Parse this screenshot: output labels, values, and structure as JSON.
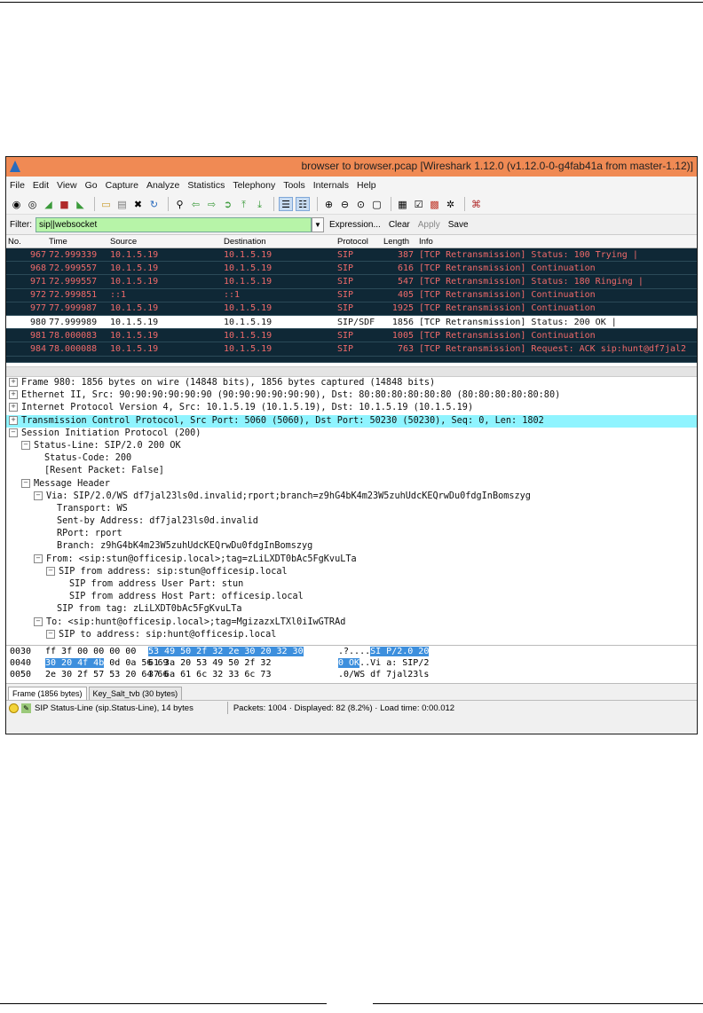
{
  "window": {
    "title": "browser to browser.pcap  [Wireshark 1.12.0  (v1.12.0-0-g4fab41a from master-1.12)]"
  },
  "menu": [
    "File",
    "Edit",
    "View",
    "Go",
    "Capture",
    "Analyze",
    "Statistics",
    "Telephony",
    "Tools",
    "Internals",
    "Help"
  ],
  "filter": {
    "label": "Filter:",
    "value": "sip||websocket",
    "expression": "Expression...",
    "clear": "Clear",
    "apply": "Apply",
    "save": "Save"
  },
  "packet_list": {
    "columns": [
      "No.",
      "Time",
      "Source",
      "Destination",
      "Protocol",
      "Length",
      "Info"
    ],
    "rows": [
      {
        "no": "967",
        "time": "72.999339",
        "src": "10.1.5.19",
        "dst": "10.1.5.19",
        "proto": "SIP",
        "len": "387",
        "info": "[TCP Retransmission] Status: 100 Trying |"
      },
      {
        "no": "968",
        "time": "72.999557",
        "src": "10.1.5.19",
        "dst": "10.1.5.19",
        "proto": "SIP",
        "len": "616",
        "info": "[TCP Retransmission] Continuation"
      },
      {
        "no": "971",
        "time": "72.999557",
        "src": "10.1.5.19",
        "dst": "10.1.5.19",
        "proto": "SIP",
        "len": "547",
        "info": "[TCP Retransmission] Status: 180 Ringing |"
      },
      {
        "no": "972",
        "time": "72.999851",
        "src": "::1",
        "dst": "::1",
        "proto": "SIP",
        "len": "405",
        "info": "[TCP Retransmission] Continuation"
      },
      {
        "no": "977",
        "time": "77.999987",
        "src": "10.1.5.19",
        "dst": "10.1.5.19",
        "proto": "SIP",
        "len": "1925",
        "info": "[TCP Retransmission] Continuation"
      },
      {
        "no": "980",
        "time": "77.999989",
        "src": "10.1.5.19",
        "dst": "10.1.5.19",
        "proto": "SIP/SDF",
        "len": "1856",
        "info": "[TCP Retransmission] Status: 200 OK |"
      },
      {
        "no": "981",
        "time": "78.000083",
        "src": "10.1.5.19",
        "dst": "10.1.5.19",
        "proto": "SIP",
        "len": "1005",
        "info": "[TCP Retransmission] Continuation"
      },
      {
        "no": "984",
        "time": "78.000088",
        "src": "10.1.5.19",
        "dst": "10.1.5.19",
        "proto": "SIP",
        "len": "763",
        "info": "[TCP Retransmission] Request: ACK sip:hunt@df7jal2"
      }
    ]
  },
  "details": [
    {
      "indent": 0,
      "exp": "+",
      "text": "Frame 980: 1856 bytes on wire (14848 bits), 1856 bytes captured (14848 bits)"
    },
    {
      "indent": 0,
      "exp": "+",
      "text": "Ethernet II, Src: 90:90:90:90:90:90 (90:90:90:90:90:90), Dst: 80:80:80:80:80:80 (80:80:80:80:80:80)"
    },
    {
      "indent": 0,
      "exp": "+",
      "text": "Internet Protocol Version 4, Src: 10.1.5.19 (10.1.5.19), Dst: 10.1.5.19 (10.1.5.19)"
    },
    {
      "indent": 0,
      "exp": "+",
      "text": "Transmission Control Protocol, Src Port: 5060 (5060), Dst Port: 50230 (50230), Seq: 0, Len: 1802",
      "hl": true
    },
    {
      "indent": 0,
      "exp": "-",
      "text": "Session Initiation Protocol (200)"
    },
    {
      "indent": 1,
      "exp": "-",
      "text": "Status-Line: SIP/2.0 200 OK"
    },
    {
      "indent": 3,
      "exp": "",
      "text": "Status-Code: 200"
    },
    {
      "indent": 3,
      "exp": "",
      "text": "[Resent Packet: False]"
    },
    {
      "indent": 1,
      "exp": "-",
      "text": "Message Header"
    },
    {
      "indent": 2,
      "exp": "-",
      "text": "Via: SIP/2.0/WS df7jal23ls0d.invalid;rport;branch=z9hG4bK4m23W5zuhUdcKEQrwDu0fdgInBomszyg"
    },
    {
      "indent": 4,
      "exp": "",
      "text": "Transport: WS"
    },
    {
      "indent": 4,
      "exp": "",
      "text": "Sent-by Address: df7jal23ls0d.invalid"
    },
    {
      "indent": 4,
      "exp": "",
      "text": "RPort: rport"
    },
    {
      "indent": 4,
      "exp": "",
      "text": "Branch: z9hG4bK4m23W5zuhUdcKEQrwDu0fdgInBomszyg"
    },
    {
      "indent": 2,
      "exp": "-",
      "text": "From: <sip:stun@officesip.local>;tag=zLiLXDT0bAc5FgKvuLTa"
    },
    {
      "indent": 3,
      "exp": "-",
      "text": "SIP from address: sip:stun@officesip.local"
    },
    {
      "indent": 5,
      "exp": "",
      "text": "SIP from address User Part: stun"
    },
    {
      "indent": 5,
      "exp": "",
      "text": "SIP from address Host Part: officesip.local"
    },
    {
      "indent": 4,
      "exp": "",
      "text": "SIP from tag: zLiLXDT0bAc5FgKvuLTa"
    },
    {
      "indent": 2,
      "exp": "-",
      "text": "To: <sip:hunt@officesip.local>;tag=MgizazxLTXl0iIwGTRAd"
    },
    {
      "indent": 3,
      "exp": "-",
      "text": "SIP to address: sip:hunt@officesip.local"
    }
  ],
  "hex": [
    {
      "off": "0030",
      "b1": "ff 3f 00 00 00 00",
      "b2": "53 49  50 2f 32 2e 30 20 32 30",
      "a1": ".?....",
      "a2": "SI P/2.0 20",
      "sel1": false,
      "sel2": true
    },
    {
      "off": "0040",
      "b1": "30 20 4f 4b",
      "b1b": " 0d 0a 56 69",
      "b2": "61 3a 20 53 49 50 2f 32",
      "a1": "0 OK",
      "a2": "..Vi a: SIP/2",
      "sel1": true,
      "sel2": false
    },
    {
      "off": "0050",
      "b1": "2e 30 2f 57 53 20 64 66",
      "b2": "37 6a 61 6c 32 33 6c 73",
      "a1": ".0/WS df 7jal23ls",
      "a2": "",
      "sel1": false,
      "sel2": false
    }
  ],
  "tabs": [
    "Frame (1856 bytes)",
    "Key_Salt_tvb (30 bytes)"
  ],
  "status": {
    "field": "SIP Status-Line (sip.Status-Line), 14 bytes",
    "packets": "Packets: 1004 · Displayed: 82 (8.2%) · Load time: 0:00.012"
  },
  "colors": {
    "row_bg": "#0f2836",
    "row_fg": "#f06a6a",
    "filter_ok": "#b7f4a8",
    "highlight": "#8ff4ff",
    "titlebar": "#f08a54"
  }
}
